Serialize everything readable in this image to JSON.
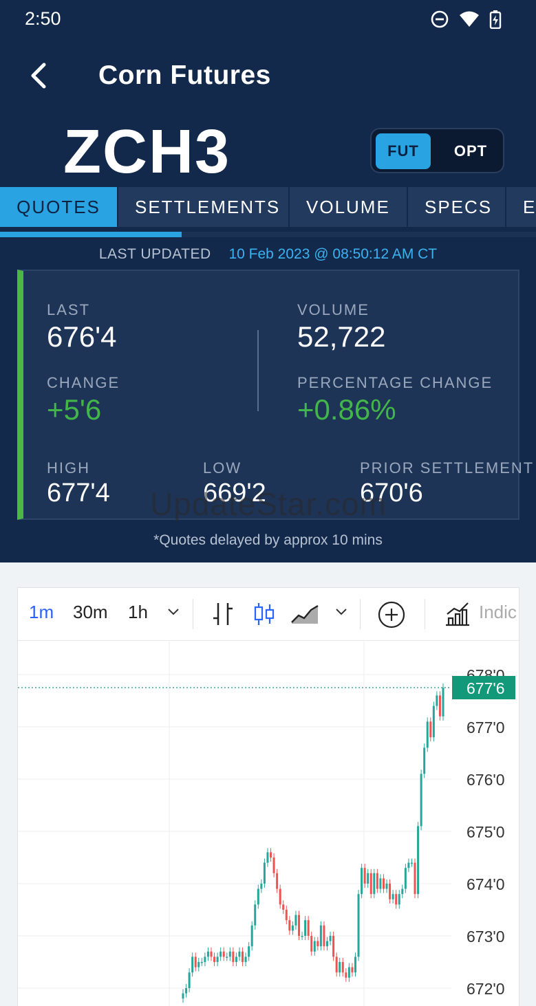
{
  "status_bar": {
    "time": "2:50"
  },
  "header": {
    "title": "Corn Futures",
    "symbol": "ZCH3"
  },
  "toggle": {
    "fut": "FUT",
    "opt": "OPT",
    "selected": "FUT"
  },
  "tabs": [
    {
      "label": "QUOTES",
      "active": true
    },
    {
      "label": "SETTLEMENTS",
      "active": false
    },
    {
      "label": "VOLUME",
      "active": false
    },
    {
      "label": "SPECS",
      "active": false
    },
    {
      "label": "EX",
      "active": false
    }
  ],
  "last_updated": {
    "label": "LAST UPDATED",
    "value": "10 Feb 2023 @ 08:50:12 AM CT"
  },
  "quote": {
    "last": {
      "label": "LAST",
      "value": "676'4"
    },
    "volume": {
      "label": "VOLUME",
      "value": "52,722"
    },
    "change": {
      "label": "CHANGE",
      "value": "+5'6"
    },
    "pct_change": {
      "label": "PERCENTAGE CHANGE",
      "value": "+0.86%"
    },
    "high": {
      "label": "HIGH",
      "value": "677'4"
    },
    "low": {
      "label": "LOW",
      "value": "669'2"
    },
    "prior": {
      "label": "PRIOR SETTLEMENT",
      "value": "670'6"
    },
    "accent_color": "#4cb748",
    "positive_color": "#43b649"
  },
  "watermark": "UpdateStar.com",
  "delay_note": "*Quotes delayed by approx 10 mins",
  "chart_toolbar": {
    "intervals": [
      "1m",
      "30m",
      "1h"
    ],
    "active_interval": "1m",
    "icons": [
      "chevron-down-icon",
      "bar-chart-icon",
      "candlestick-icon",
      "area-chart-icon",
      "chevron-down-icon",
      "add-circle-icon",
      "indicators-icon"
    ],
    "indicators_label": "Indic"
  },
  "chart_data": {
    "type": "candlestick",
    "ylim": [
      671.9,
      678.3
    ],
    "y_ticks": [
      "678'0",
      "677'0",
      "676'0",
      "675'0",
      "674'0",
      "673'0",
      "672'0"
    ],
    "current_price_label": "677'6",
    "current_price": 677.75,
    "up_color": "#26a69a",
    "down_color": "#ef5350",
    "price_tag_color": "#12997a",
    "candles_close": [
      671.9,
      672.0,
      672.3,
      672.6,
      672.4,
      672.5,
      672.5,
      672.6,
      672.7,
      672.6,
      672.5,
      672.6,
      672.7,
      672.6,
      672.6,
      672.7,
      672.5,
      672.6,
      672.7,
      672.5,
      672.6,
      672.8,
      673.2,
      673.6,
      673.9,
      674.0,
      674.4,
      674.6,
      674.5,
      674.2,
      673.9,
      673.6,
      673.5,
      673.3,
      673.1,
      673.2,
      673.4,
      673.0,
      673.0,
      673.3,
      673.0,
      672.7,
      672.9,
      672.8,
      673.2,
      672.8,
      672.9,
      673.0,
      672.6,
      672.3,
      672.5,
      672.3,
      672.2,
      672.4,
      672.3,
      672.6,
      673.8,
      674.3,
      674.0,
      674.2,
      673.8,
      674.2,
      673.9,
      674.1,
      673.9,
      674.0,
      673.7,
      673.8,
      673.6,
      673.8,
      673.9,
      674.3,
      674.4,
      674.4,
      673.8,
      675.1,
      676.1,
      676.6,
      677.1,
      676.8,
      677.4,
      677.6,
      677.2,
      677.75
    ]
  }
}
